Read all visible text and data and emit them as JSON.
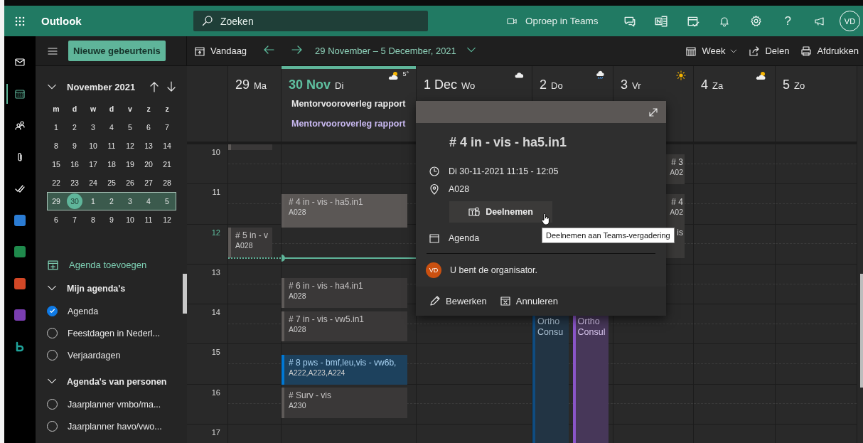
{
  "app": {
    "name": "Outlook"
  },
  "search": {
    "placeholder": "Zoeken"
  },
  "header_actions": {
    "teams_call": "Oproep in Teams",
    "help": "?",
    "avatar": "VD"
  },
  "rail": [
    {
      "kind": "mail",
      "selected": false
    },
    {
      "kind": "calendar",
      "selected": true
    },
    {
      "kind": "people",
      "selected": false
    },
    {
      "kind": "files",
      "selected": false
    },
    {
      "kind": "todo",
      "selected": false
    },
    {
      "kind": "word",
      "selected": false
    },
    {
      "kind": "excel",
      "selected": false
    },
    {
      "kind": "powerpoint",
      "selected": false
    },
    {
      "kind": "onenote",
      "selected": false
    },
    {
      "kind": "bookings",
      "selected": false
    }
  ],
  "toolbar": {
    "new_event": "Nieuwe gebeurtenis",
    "today": "Vandaag",
    "range": "29 November – 5 December, 2021",
    "view": "Week",
    "share": "Delen",
    "print": "Afdrukken"
  },
  "mini_calendar": {
    "title": "November 2021",
    "weekdays": [
      "m",
      "d",
      "w",
      "d",
      "v",
      "z",
      "z"
    ],
    "weeks": [
      {
        "selected": false,
        "days": [
          {
            "label": "1",
            "today": false
          },
          {
            "label": "2",
            "today": false
          },
          {
            "label": "3",
            "today": false
          },
          {
            "label": "4",
            "today": false
          },
          {
            "label": "5",
            "today": false
          },
          {
            "label": "6",
            "today": false
          },
          {
            "label": "7",
            "today": false
          }
        ]
      },
      {
        "selected": false,
        "days": [
          {
            "label": "8",
            "today": false
          },
          {
            "label": "9",
            "today": false
          },
          {
            "label": "10",
            "today": false
          },
          {
            "label": "11",
            "today": false
          },
          {
            "label": "12",
            "today": false
          },
          {
            "label": "13",
            "today": false
          },
          {
            "label": "14",
            "today": false
          }
        ]
      },
      {
        "selected": false,
        "days": [
          {
            "label": "15",
            "today": false
          },
          {
            "label": "16",
            "today": false
          },
          {
            "label": "17",
            "today": false
          },
          {
            "label": "18",
            "today": false
          },
          {
            "label": "19",
            "today": false
          },
          {
            "label": "20",
            "today": false
          },
          {
            "label": "21",
            "today": false
          }
        ]
      },
      {
        "selected": false,
        "days": [
          {
            "label": "22",
            "today": false
          },
          {
            "label": "23",
            "today": false
          },
          {
            "label": "24",
            "today": false
          },
          {
            "label": "25",
            "today": false
          },
          {
            "label": "26",
            "today": false
          },
          {
            "label": "27",
            "today": false
          },
          {
            "label": "28",
            "today": false
          }
        ]
      },
      {
        "selected": true,
        "days": [
          {
            "label": "29",
            "today": false
          },
          {
            "label": "30",
            "today": true
          },
          {
            "label": "1",
            "today": false
          },
          {
            "label": "2",
            "today": false
          },
          {
            "label": "3",
            "today": false
          },
          {
            "label": "4",
            "today": false
          },
          {
            "label": "5",
            "today": false
          }
        ]
      },
      {
        "selected": false,
        "days": [
          {
            "label": "6",
            "today": false
          },
          {
            "label": "7",
            "today": false
          },
          {
            "label": "8",
            "today": false
          },
          {
            "label": "9",
            "today": false
          },
          {
            "label": "10",
            "today": false
          },
          {
            "label": "11",
            "today": false
          },
          {
            "label": "12",
            "today": false
          }
        ]
      }
    ]
  },
  "add_calendar": "Agenda toevoegen",
  "groups": [
    {
      "title": "Mijn agenda's",
      "expanded": true,
      "calendars": [
        {
          "name": "Agenda",
          "checked": true
        },
        {
          "name": "Feestdagen in Nederl...",
          "checked": false
        },
        {
          "name": "Verjaardagen",
          "checked": false
        }
      ]
    },
    {
      "title": "Agenda's van personen",
      "expanded": true,
      "calendars": [
        {
          "name": "Jaarplanner vmbo/ma...",
          "checked": false
        },
        {
          "name": "Jaarplanner havo/vwo...",
          "checked": false
        }
      ]
    }
  ],
  "calendar": {
    "hours": [
      {
        "label": "10",
        "current": false
      },
      {
        "label": "11",
        "current": false
      },
      {
        "label": "12",
        "current": true
      },
      {
        "label": "13",
        "current": false
      },
      {
        "label": "14",
        "current": false
      },
      {
        "label": "15",
        "current": false
      },
      {
        "label": "16",
        "current": false
      },
      {
        "label": "17",
        "current": false
      }
    ],
    "days": [
      {
        "label": "29",
        "name": "Ma",
        "today": false,
        "events": [
          {
            "kind": "normal",
            "color": "#5e5a58",
            "selected": false
          },
          {
            "kind": "normal",
            "title": "# 5 in - v",
            "location": "A028",
            "color": "#5e5a58",
            "selected": false
          }
        ]
      },
      {
        "label": "30 Nov",
        "name": "Di",
        "today": true,
        "weather": {
          "kind": "partly-cloudy",
          "temp": "5°"
        },
        "all_day": [
          {
            "title": "Mentorvooroverleg rapport",
            "color": "#e8e8e8"
          },
          {
            "title": "Mentorvooroverleg rapport",
            "color": "#c8b8f0"
          }
        ],
        "events": [
          {
            "kind": "normal",
            "title": "# 4 in - vis - ha5.in1",
            "location": "A028",
            "color": "#5e5a58",
            "selected": true
          },
          {
            "kind": "normal",
            "title": "# 6 in - vis - ha4.in1",
            "location": "A028",
            "color": "#5e5a58",
            "selected": false
          },
          {
            "kind": "normal",
            "title": "# 7 in - vis - vw5.in1",
            "location": "A028",
            "color": "#5e5a58",
            "selected": false
          },
          {
            "kind": "normal",
            "title": "# 8 pws - bmf,leu,vis - vw6b,",
            "location": "A222,A223,A224",
            "color": "#0078d4",
            "selected": false
          },
          {
            "kind": "normal",
            "title": "# Surv - vis",
            "location": "A230",
            "color": "#5e5a58",
            "selected": false
          }
        ]
      },
      {
        "label": "1 Dec",
        "name": "Wo",
        "today": false,
        "weather": {
          "kind": "cloudy"
        }
      },
      {
        "label": "2",
        "name": "Do",
        "today": false,
        "weather": {
          "kind": "rain"
        },
        "events": [
          {
            "kind": "normal",
            "title": "Ortho Consu",
            "color": "#0f4c81",
            "selected": false
          },
          {
            "kind": "normal",
            "title": "Ortho Consul",
            "color": "#8a55c8",
            "selected": false
          }
        ]
      },
      {
        "label": "3",
        "name": "Vr",
        "today": false,
        "weather": {
          "kind": "sunny"
        },
        "events": [
          {
            "kind": "covered",
            "title": "# 3",
            "location": "A02"
          },
          {
            "kind": "covered",
            "title": "# 4",
            "location": "A02"
          },
          {
            "kind": "covered",
            "title": "is"
          }
        ]
      },
      {
        "label": "4",
        "name": "Za",
        "today": false,
        "weather": {
          "kind": "partly-cloudy"
        }
      },
      {
        "label": "5",
        "name": "Zo",
        "today": false
      }
    ]
  },
  "popup": {
    "title": "# 4 in - vis - ha5.in1",
    "when": "Di 30-11-2021 11:15 - 12:05",
    "location": "A028",
    "join": "Deelnemen",
    "calendar": "Agenda",
    "organizer_avatar": "VD",
    "organizer": "U bent de organisator.",
    "edit": "Bewerken",
    "cancel": "Annuleren"
  },
  "tooltip": "Deelnemen aan Teams-vergadering"
}
